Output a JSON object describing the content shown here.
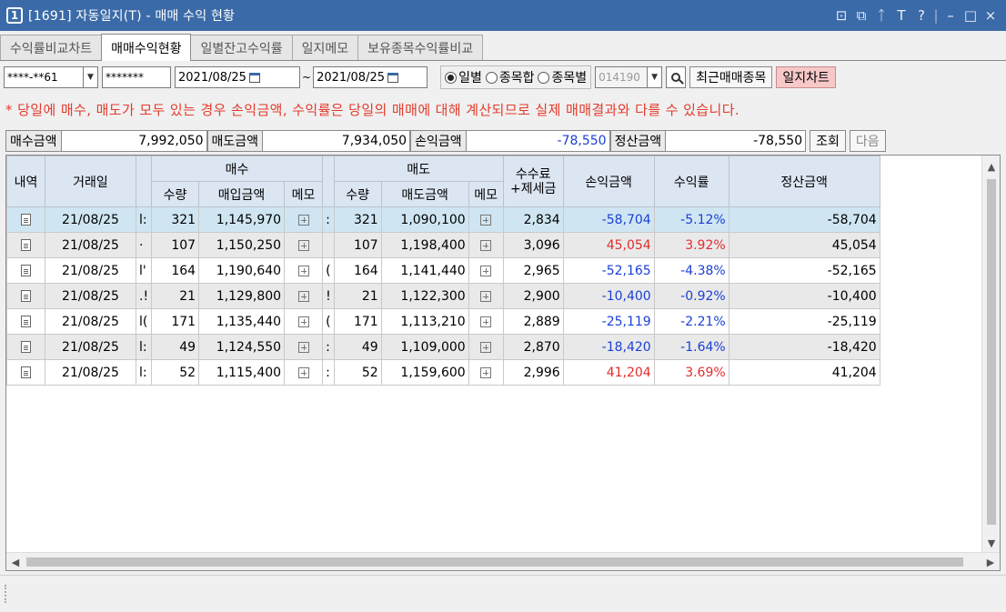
{
  "window": {
    "number": "1",
    "title": "[1691] 자동일지(T) - 매매 수익 현황",
    "controls": [
      "⊡",
      "⧉",
      "ᛏ",
      "T",
      "?",
      "–",
      "□",
      "×"
    ]
  },
  "tabs": [
    {
      "label": "수익률비교차트",
      "active": false
    },
    {
      "label": "매매수익현황",
      "active": true
    },
    {
      "label": "일별잔고수익률",
      "active": false
    },
    {
      "label": "일지메모",
      "active": false
    },
    {
      "label": "보유종목수익률비교",
      "active": false
    }
  ],
  "toolbar": {
    "account": "****-**61",
    "password": "*******",
    "date_from": "2021/08/25",
    "date_to": "2021/08/25",
    "radio_daily": "일별",
    "radio_stock_sum": "종목합",
    "radio_per_stock": "종목별",
    "stock_code": "014190",
    "recent_btn": "최근매매종목",
    "journal_chart_btn": "일지차트"
  },
  "notice": "* 당일에 매수, 매도가 모두 있는 경우 손익금액, 수익률은 당일의 매매에 대해 계산되므로 실제 매매결과와 다를 수 있습니다.",
  "summary": {
    "buy_label": "매수금액",
    "buy_value": "7,992,050",
    "sell_label": "매도금액",
    "sell_value": "7,934,050",
    "pnl_label": "손익금액",
    "pnl_value": "-78,550",
    "settle_label": "정산금액",
    "settle_value": "-78,550",
    "query_btn": "조회",
    "next_btn": "다음"
  },
  "table": {
    "headers": {
      "detail": "내역",
      "date": "거래일",
      "buy_group": "매수",
      "buy_qty": "수량",
      "buy_amount": "매입금액",
      "buy_memo": "메모",
      "sell_group": "매도",
      "sell_qty": "수량",
      "sell_amount": "매도금액",
      "sell_memo": "메모",
      "fee_line1": "수수료",
      "fee_line2": "+제세금",
      "pnl": "손익금액",
      "rate": "수익률",
      "settle": "정산금액"
    },
    "rows": [
      {
        "date": "21/08/25",
        "c1": "l:",
        "buy_qty": "321",
        "buy_amount": "1,145,970",
        "c2": ":",
        "sell_qty": "321",
        "sell_amount": "1,090,100",
        "fee": "2,834",
        "pnl": "-58,704",
        "rate": "-5.12%",
        "settle": "-58,704",
        "sign": "neg",
        "style": "sel"
      },
      {
        "date": "21/08/25",
        "c1": "·",
        "buy_qty": "107",
        "buy_amount": "1,150,250",
        "c2": "",
        "sell_qty": "107",
        "sell_amount": "1,198,400",
        "fee": "3,096",
        "pnl": "45,054",
        "rate": "3.92%",
        "settle": "45,054",
        "sign": "pos",
        "style": "alt"
      },
      {
        "date": "21/08/25",
        "c1": "l'",
        "buy_qty": "164",
        "buy_amount": "1,190,640",
        "c2": "(",
        "sell_qty": "164",
        "sell_amount": "1,141,440",
        "fee": "2,965",
        "pnl": "-52,165",
        "rate": "-4.38%",
        "settle": "-52,165",
        "sign": "neg",
        "style": ""
      },
      {
        "date": "21/08/25",
        "c1": ".!",
        "buy_qty": "21",
        "buy_amount": "1,129,800",
        "c2": "!",
        "sell_qty": "21",
        "sell_amount": "1,122,300",
        "fee": "2,900",
        "pnl": "-10,400",
        "rate": "-0.92%",
        "settle": "-10,400",
        "sign": "neg",
        "style": "alt"
      },
      {
        "date": "21/08/25",
        "c1": "l(",
        "buy_qty": "171",
        "buy_amount": "1,135,440",
        "c2": "(",
        "sell_qty": "171",
        "sell_amount": "1,113,210",
        "fee": "2,889",
        "pnl": "-25,119",
        "rate": "-2.21%",
        "settle": "-25,119",
        "sign": "neg",
        "style": ""
      },
      {
        "date": "21/08/25",
        "c1": "l:",
        "buy_qty": "49",
        "buy_amount": "1,124,550",
        "c2": ":",
        "sell_qty": "49",
        "sell_amount": "1,109,000",
        "fee": "2,870",
        "pnl": "-18,420",
        "rate": "-1.64%",
        "settle": "-18,420",
        "sign": "neg",
        "style": "alt"
      },
      {
        "date": "21/08/25",
        "c1": "l:",
        "buy_qty": "52",
        "buy_amount": "1,115,400",
        "c2": ":",
        "sell_qty": "52",
        "sell_amount": "1,159,600",
        "fee": "2,996",
        "pnl": "41,204",
        "rate": "3.69%",
        "settle": "41,204",
        "sign": "pos",
        "style": ""
      }
    ]
  },
  "colors": {
    "title_bar": "#3b6aa8",
    "negative": "#1b3fd6",
    "positive": "#e22d2d",
    "notice": "#e43b2c",
    "selected_row": "#cfe6f2",
    "header": "#dce6f2"
  }
}
